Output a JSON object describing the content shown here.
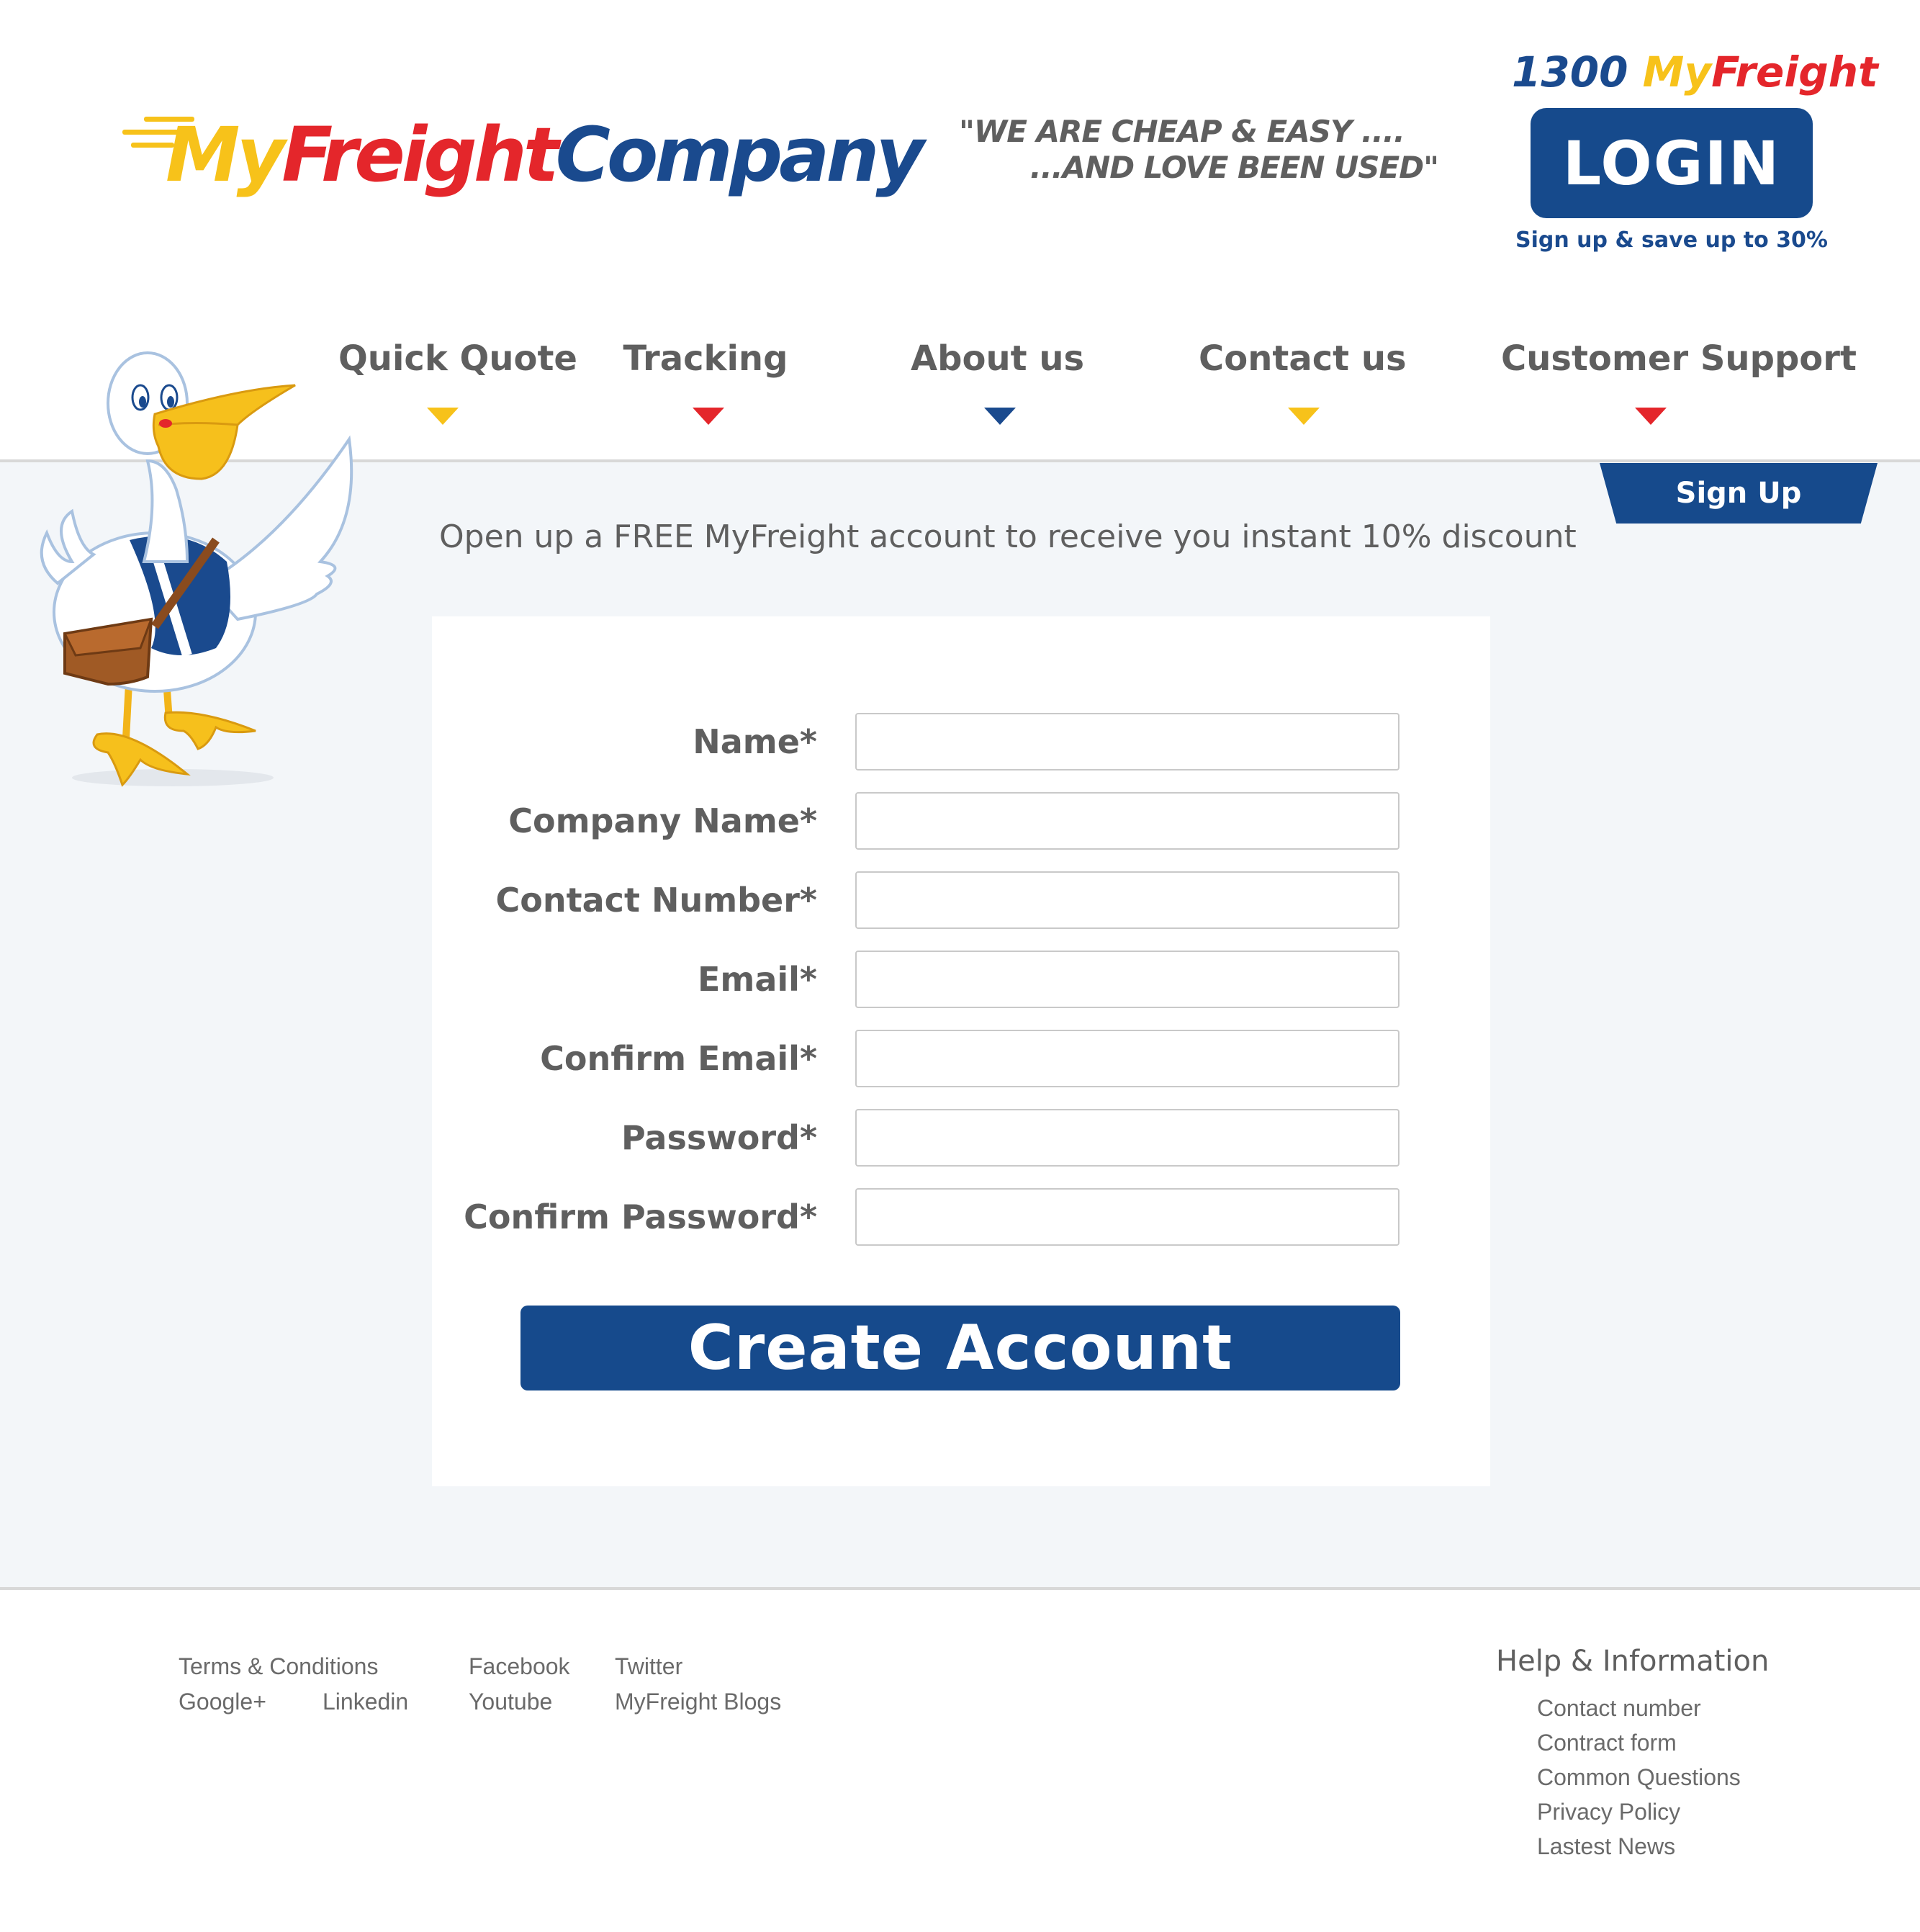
{
  "header": {
    "logo": {
      "my": "My",
      "freight": "Freight",
      "company": "Company"
    },
    "slogan": {
      "line1": "\"WE ARE CHEAP & EASY ....",
      "line2": "...AND LOVE BEEN USED\""
    },
    "phone": {
      "number": "1300 ",
      "my": "My",
      "freight": "Freight"
    },
    "login_label": "LOGIN",
    "login_subtext": "Sign up & save up to 30%"
  },
  "nav": {
    "items": [
      {
        "label": "Quick Quote",
        "arrow_color": "#f7c21a"
      },
      {
        "label": "Tracking",
        "arrow_color": "#e4262b"
      },
      {
        "label": "About us",
        "arrow_color": "#1a4a8e"
      },
      {
        "label": "Contact us",
        "arrow_color": "#f7c21a"
      },
      {
        "label": "Customer Support",
        "arrow_color": "#e4262b"
      }
    ]
  },
  "main": {
    "tab_label": "Sign Up",
    "intro": "Open up a FREE MyFreight account to receive you instant 10% discount",
    "form": {
      "fields": [
        {
          "label": "Name*",
          "value": ""
        },
        {
          "label": "Company Name*",
          "value": ""
        },
        {
          "label": "Contact Number*",
          "value": ""
        },
        {
          "label": "Email*",
          "value": ""
        },
        {
          "label": "Confirm Email*",
          "value": ""
        },
        {
          "label": "Password*",
          "value": ""
        },
        {
          "label": "Confirm Password*",
          "value": ""
        }
      ],
      "submit_label": "Create Account"
    }
  },
  "footer": {
    "links": {
      "terms": "Terms & Conditions",
      "facebook": "Facebook",
      "twitter": "Twitter",
      "google": "Google+",
      "linkedin": "Linkedin",
      "youtube": "Youtube",
      "blogs": "MyFreight Blogs"
    },
    "help": {
      "title": "Help & Information",
      "items": [
        "Contact number",
        "Contract form",
        "Common Questions",
        "Privacy Policy",
        "Lastest News"
      ]
    }
  },
  "colors": {
    "brand_blue": "#164a8c",
    "brand_yellow": "#f7c21a",
    "brand_red": "#e4262b",
    "text_gray": "#5f5f5f",
    "page_bg": "#f3f6f9"
  }
}
